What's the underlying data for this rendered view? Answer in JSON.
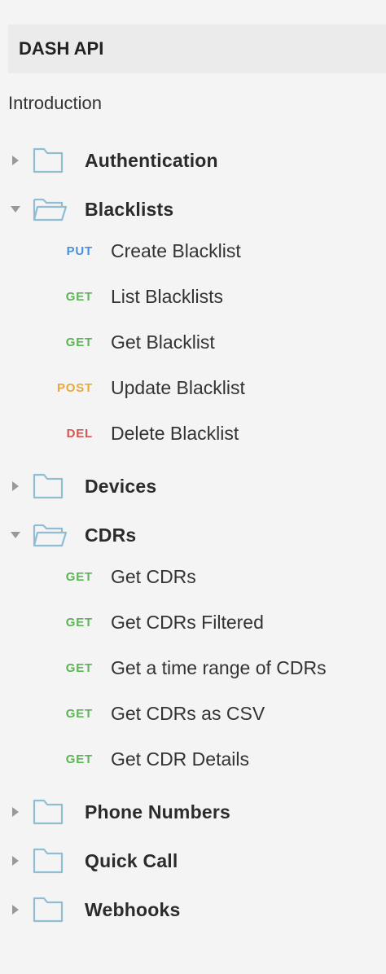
{
  "header": {
    "title": "DASH API"
  },
  "intro": {
    "label": "Introduction"
  },
  "folders": [
    {
      "label": "Authentication",
      "expanded": false
    },
    {
      "label": "Blacklists",
      "expanded": true,
      "requests": [
        {
          "method": "PUT",
          "label": "Create Blacklist"
        },
        {
          "method": "GET",
          "label": "List Blacklists"
        },
        {
          "method": "GET",
          "label": "Get Blacklist"
        },
        {
          "method": "POST",
          "label": "Update Blacklist"
        },
        {
          "method": "DEL",
          "label": "Delete Blacklist"
        }
      ]
    },
    {
      "label": "Devices",
      "expanded": false
    },
    {
      "label": "CDRs",
      "expanded": true,
      "requests": [
        {
          "method": "GET",
          "label": "Get CDRs"
        },
        {
          "method": "GET",
          "label": "Get CDRs Filtered"
        },
        {
          "method": "GET",
          "label": "Get a time range of CDRs"
        },
        {
          "method": "GET",
          "label": "Get CDRs as CSV"
        },
        {
          "method": "GET",
          "label": "Get CDR Details"
        }
      ]
    },
    {
      "label": "Phone Numbers",
      "expanded": false
    },
    {
      "label": "Quick Call",
      "expanded": false
    },
    {
      "label": "Webhooks",
      "expanded": false
    }
  ],
  "colors": {
    "PUT": "#4a90d9",
    "GET": "#5ab552",
    "POST": "#e8a93a",
    "DEL": "#d9534f",
    "folder_icon": "#8fbdd3"
  }
}
